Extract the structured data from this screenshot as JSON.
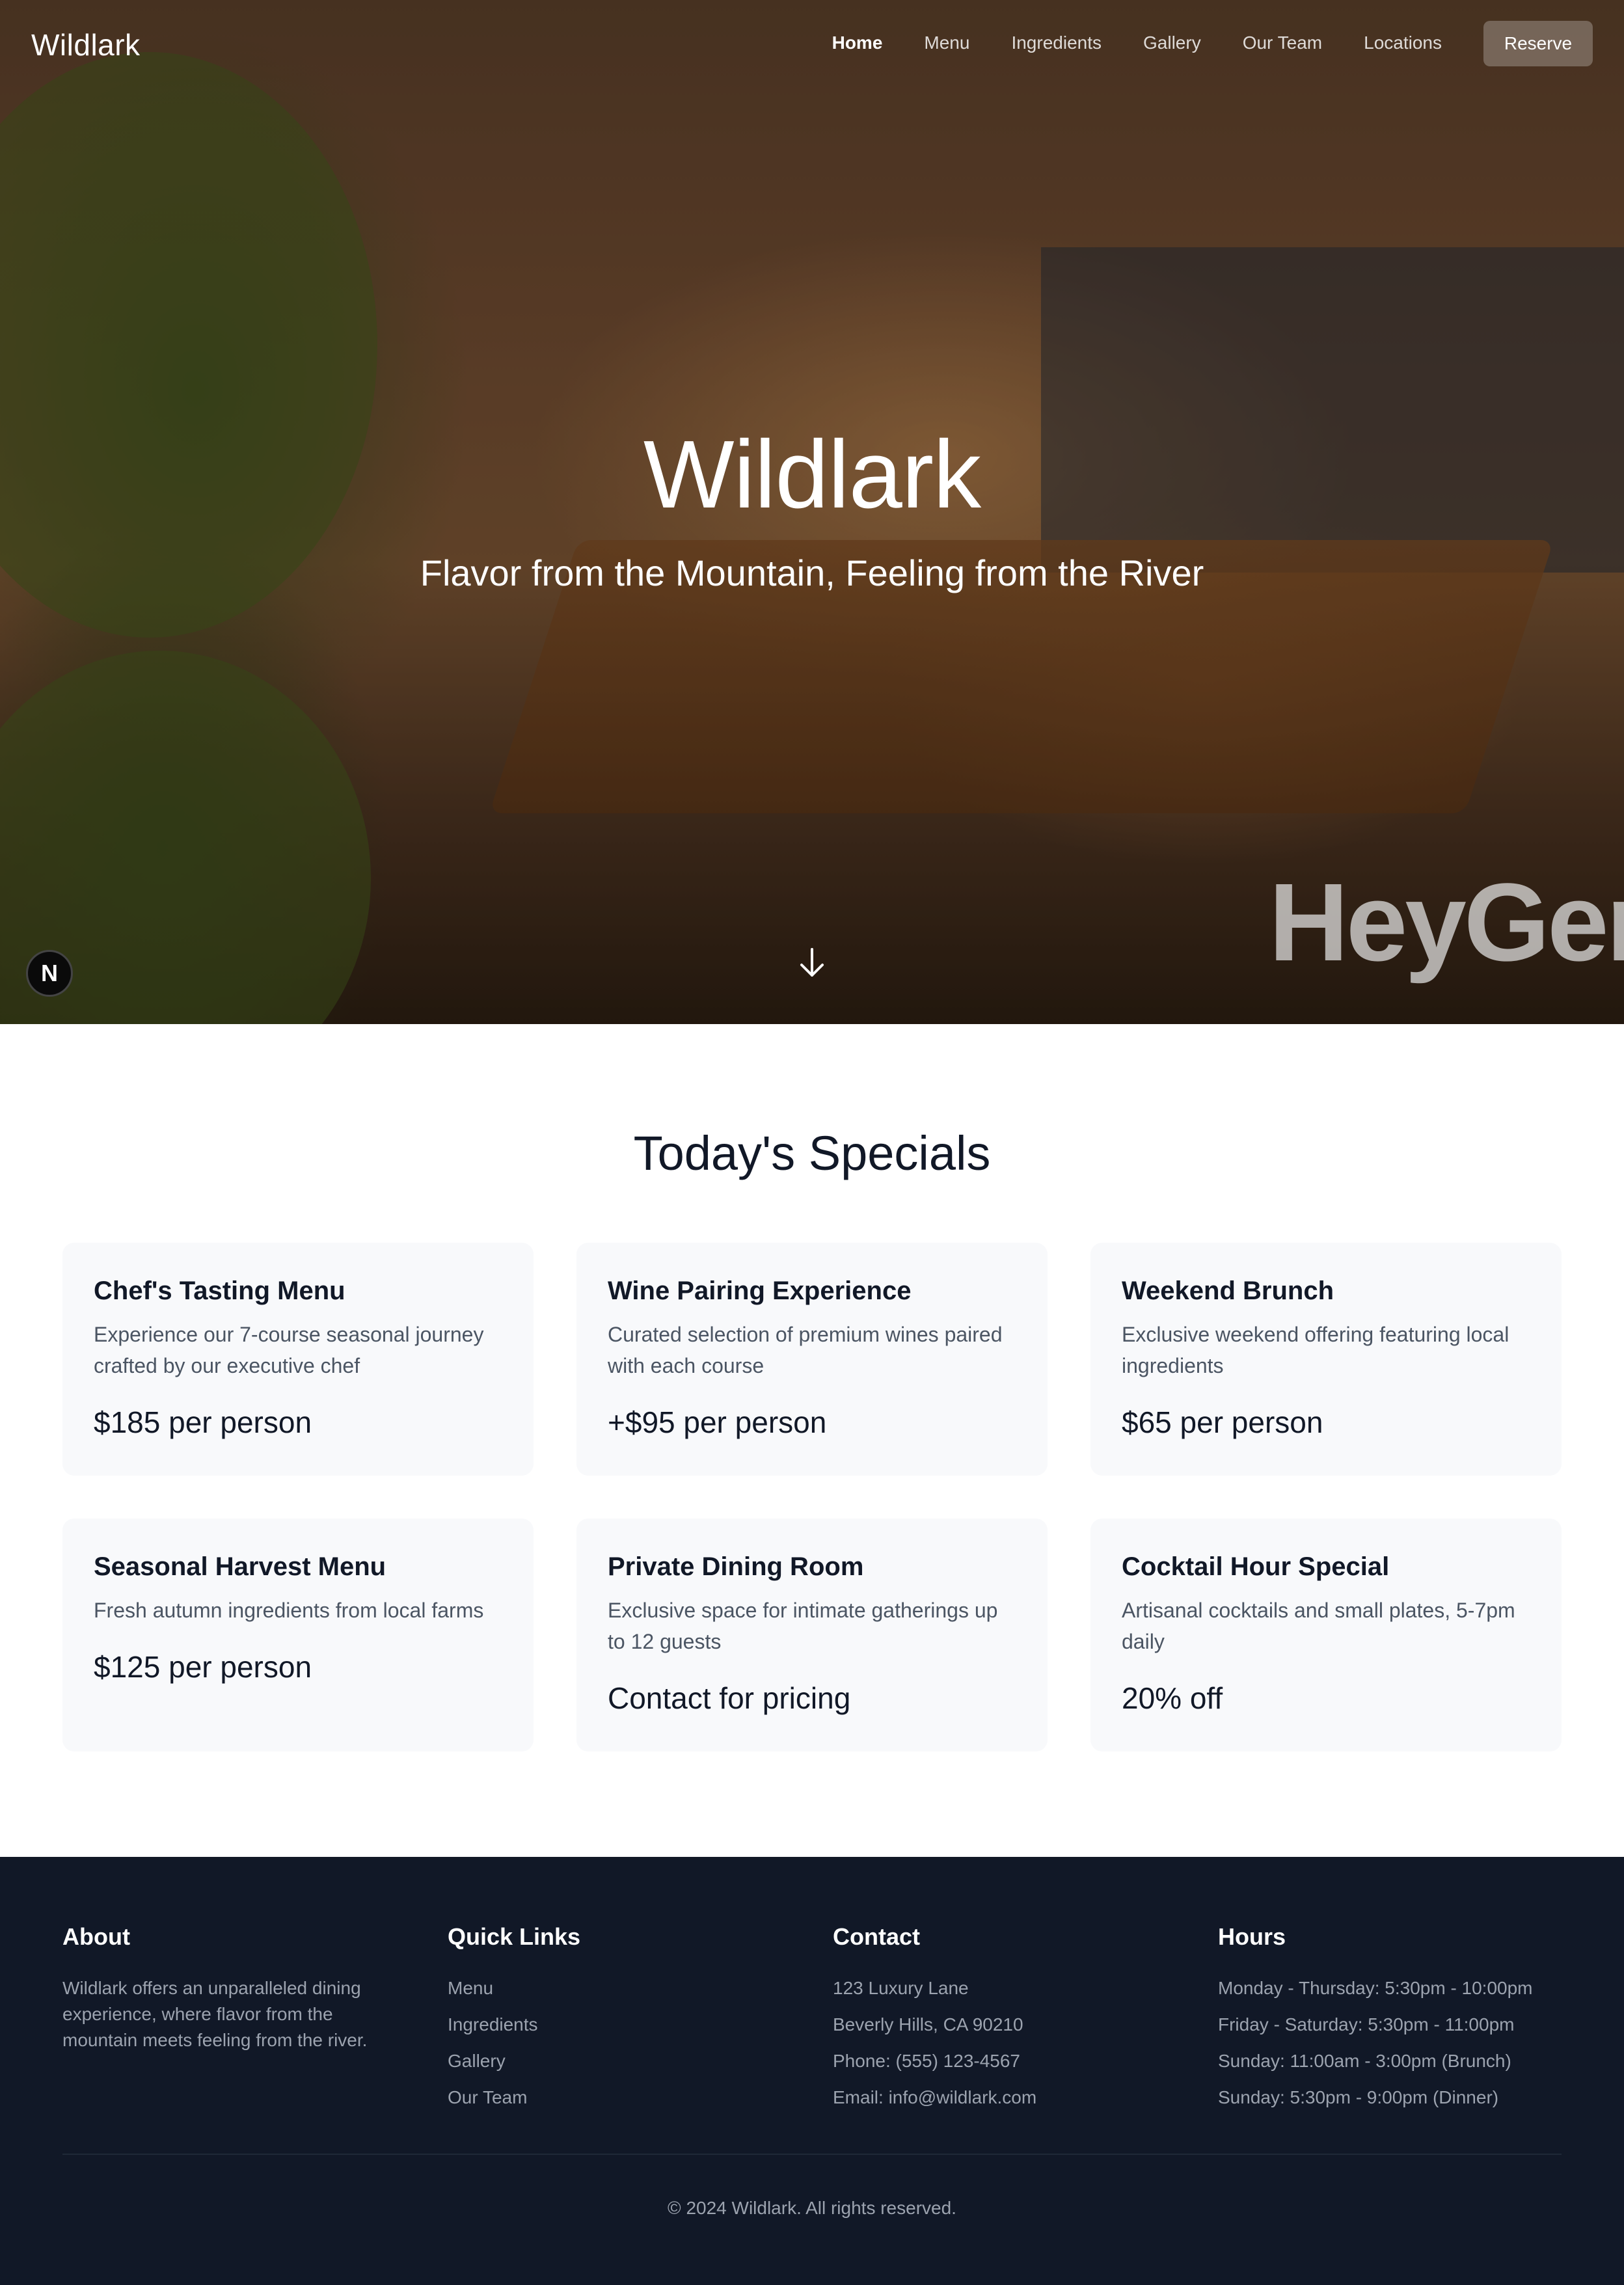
{
  "nav": {
    "brand": "Wildlark",
    "links": [
      "Home",
      "Menu",
      "Ingredients",
      "Gallery",
      "Our Team",
      "Locations"
    ],
    "active": "Home",
    "reserve_label": "Reserve"
  },
  "hero": {
    "title": "Wildlark",
    "tagline": "Flavor from the Mountain, Feeling from the River",
    "badge_letter": "N",
    "watermark": "HeyGen",
    "scroll_icon": "arrow-down-icon"
  },
  "specials": {
    "title": "Today's Specials",
    "cards": [
      {
        "title": "Chef's Tasting Menu",
        "desc": "Experience our 7-course seasonal journey crafted by our executive chef",
        "price": "$185 per person"
      },
      {
        "title": "Wine Pairing Experience",
        "desc": "Curated selection of premium wines paired with each course",
        "price": "+$95 per person"
      },
      {
        "title": "Weekend Brunch",
        "desc": "Exclusive weekend offering featuring local ingredients",
        "price": "$65 per person"
      },
      {
        "title": "Seasonal Harvest Menu",
        "desc": "Fresh autumn ingredients from local farms",
        "price": "$125 per person"
      },
      {
        "title": "Private Dining Room",
        "desc": "Exclusive space for intimate gatherings up to 12 guests",
        "price": "Contact for pricing"
      },
      {
        "title": "Cocktail Hour Special",
        "desc": "Artisanal cocktails and small plates, 5-7pm daily",
        "price": "20% off"
      }
    ]
  },
  "footer": {
    "about": {
      "title": "About",
      "text": "Wildlark offers an unparalleled dining experience, where flavor from the mountain meets feeling from the river."
    },
    "quick_links": {
      "title": "Quick Links",
      "items": [
        "Menu",
        "Ingredients",
        "Gallery",
        "Our Team"
      ]
    },
    "contact": {
      "title": "Contact",
      "items": [
        "123 Luxury Lane",
        "Beverly Hills, CA 90210",
        "Phone: (555) 123-4567",
        "Email: info@wildlark.com"
      ]
    },
    "hours": {
      "title": "Hours",
      "items": [
        "Monday - Thursday: 5:30pm - 10:00pm",
        "Friday - Saturday: 5:30pm - 11:00pm",
        "Sunday: 11:00am - 3:00pm (Brunch)",
        "Sunday: 5:30pm - 9:00pm (Dinner)"
      ]
    },
    "copyright": "© 2024 Wildlark. All rights reserved."
  },
  "colors": {
    "footer_bg": "#111827",
    "card_bg": "#f8f9fb",
    "text_dark": "#111827",
    "text_muted": "#4b5563"
  }
}
